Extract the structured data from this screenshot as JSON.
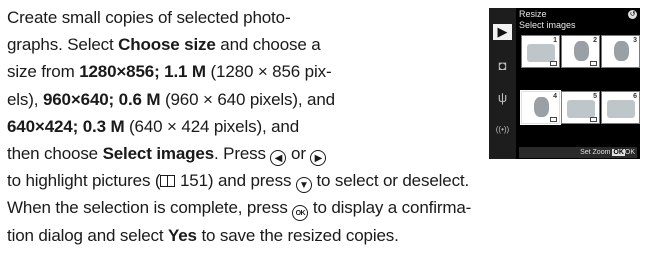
{
  "text": {
    "l1": "Create small copies of selected photo-",
    "l2a": "graphs. Select ",
    "l2b": "Choose size",
    "l2c": " and choose a",
    "l3a": "size from ",
    "l3b": "1280×856; 1.1 M",
    "l3c": " (1280 × 856 pix-",
    "l4a": "els), ",
    "l4b": "960×640; 0.6 M",
    "l4c": " (960 × 640 pixels), and",
    "l5a": "640×424; 0.3 M",
    "l5b": " (640 × 424 pixels), and",
    "l6a": "then choose ",
    "l6b": "Select images",
    "l6c": ". Press ",
    "l6d": " or ",
    "l7a": "to highlight pictures (",
    "l7b": " 151) and press ",
    "l7c": " to select or deselect.",
    "l8a": "When the selection is complete, press ",
    "l8b": " to display a confirma-",
    "l9a": "tion dialog and select ",
    "l9b": "Yes",
    "l9c": " to save the resized copies."
  },
  "glyphs": {
    "left": "◀",
    "right": "▶",
    "center": "▼",
    "ok": "OK"
  },
  "camera": {
    "title": "Resize",
    "subtitle": "Select images",
    "back": "↺",
    "thumbs": [
      "1",
      "2",
      "3",
      "4",
      "5",
      "6"
    ],
    "bottom_bar": "Set  Zoom ",
    "bottom_ok": "OK",
    "bottom_ok_label": "OK",
    "side_icons": [
      "▶",
      "◘",
      "ψ",
      "((•))"
    ]
  }
}
